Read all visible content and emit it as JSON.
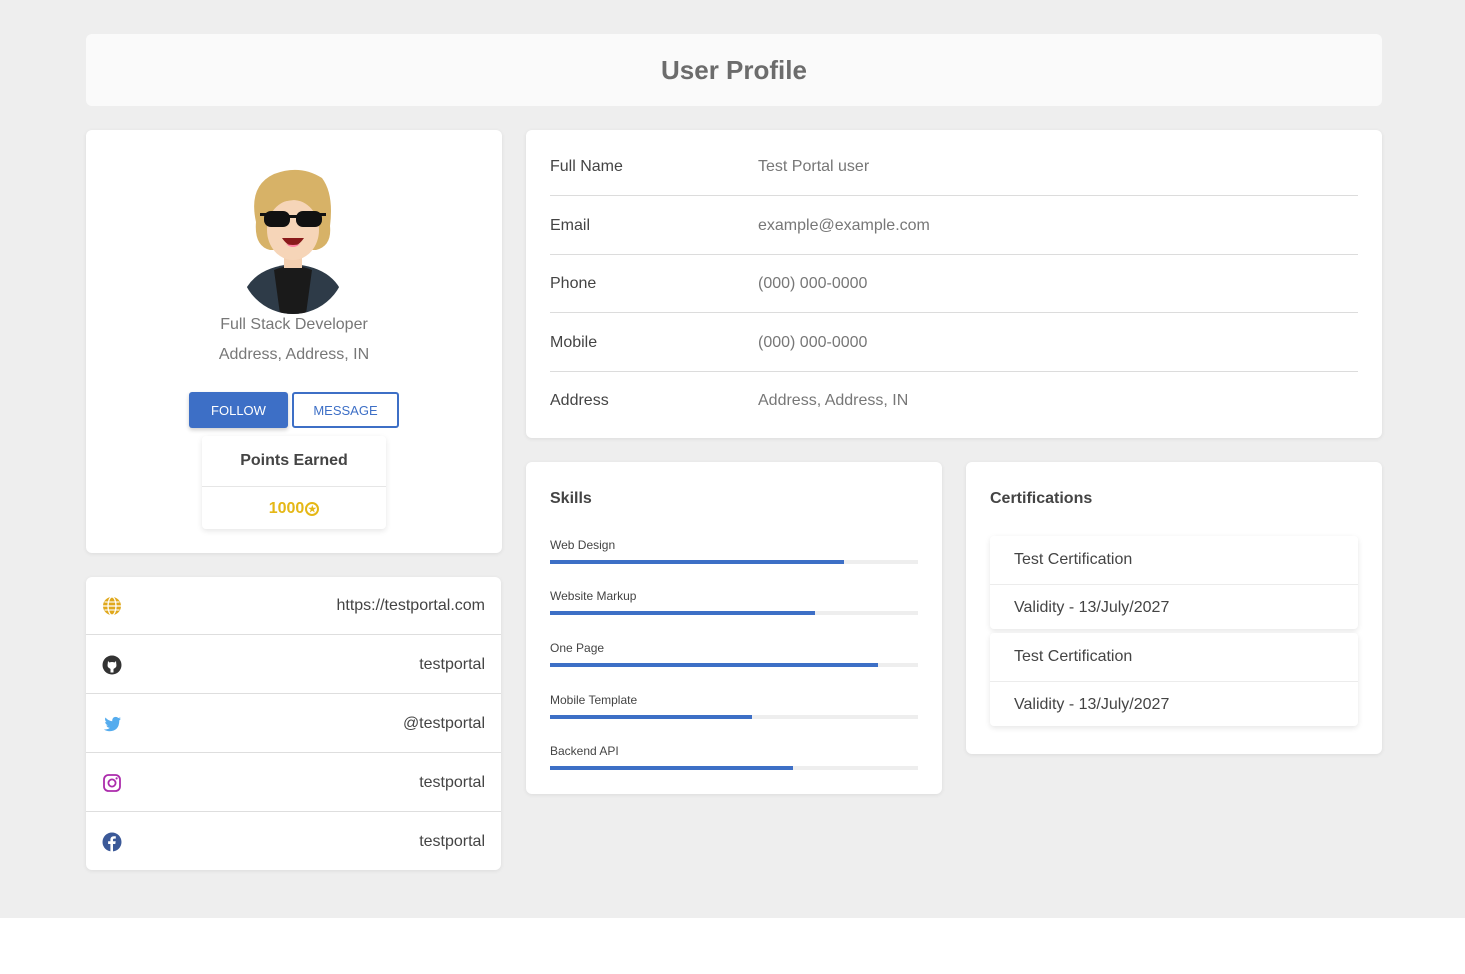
{
  "page": {
    "title": "User Profile"
  },
  "profile": {
    "role": "Full Stack Developer",
    "address": "Address, Address, IN",
    "follow_label": "FOLLOW",
    "message_label": "MESSAGE",
    "points_title": "Points Earned",
    "points_value": "1000"
  },
  "social": [
    {
      "icon": "globe-icon",
      "value": "https://testportal.com",
      "color": "#e0a81c"
    },
    {
      "icon": "github-icon",
      "value": "testportal",
      "color": "#333333"
    },
    {
      "icon": "twitter-icon",
      "value": "@testportal",
      "color": "#55acee"
    },
    {
      "icon": "instagram-icon",
      "value": "testportal",
      "color": "#ac2bac"
    },
    {
      "icon": "facebook-icon",
      "value": "testportal",
      "color": "#3b5998"
    }
  ],
  "details": [
    {
      "label": "Full Name",
      "value": "Test Portal user"
    },
    {
      "label": "Email",
      "value": "example@example.com"
    },
    {
      "label": "Phone",
      "value": "(000) 000-0000"
    },
    {
      "label": "Mobile",
      "value": "(000) 000-0000"
    },
    {
      "label": "Address",
      "value": "Address, Address, IN"
    }
  ],
  "skills": {
    "title": "Skills",
    "items": [
      {
        "name": "Web Design",
        "percent": 80
      },
      {
        "name": "Website Markup",
        "percent": 72
      },
      {
        "name": "One Page",
        "percent": 89
      },
      {
        "name": "Mobile Template",
        "percent": 55
      },
      {
        "name": "Backend API",
        "percent": 66
      }
    ]
  },
  "certifications": {
    "title": "Certifications",
    "items": [
      {
        "name": "Test Certification",
        "validity": "Validity - 13/July/2027"
      },
      {
        "name": "Test Certification",
        "validity": "Validity - 13/July/2027"
      }
    ]
  },
  "colors": {
    "accent": "#3d6fc6",
    "points": "#e5b716"
  }
}
